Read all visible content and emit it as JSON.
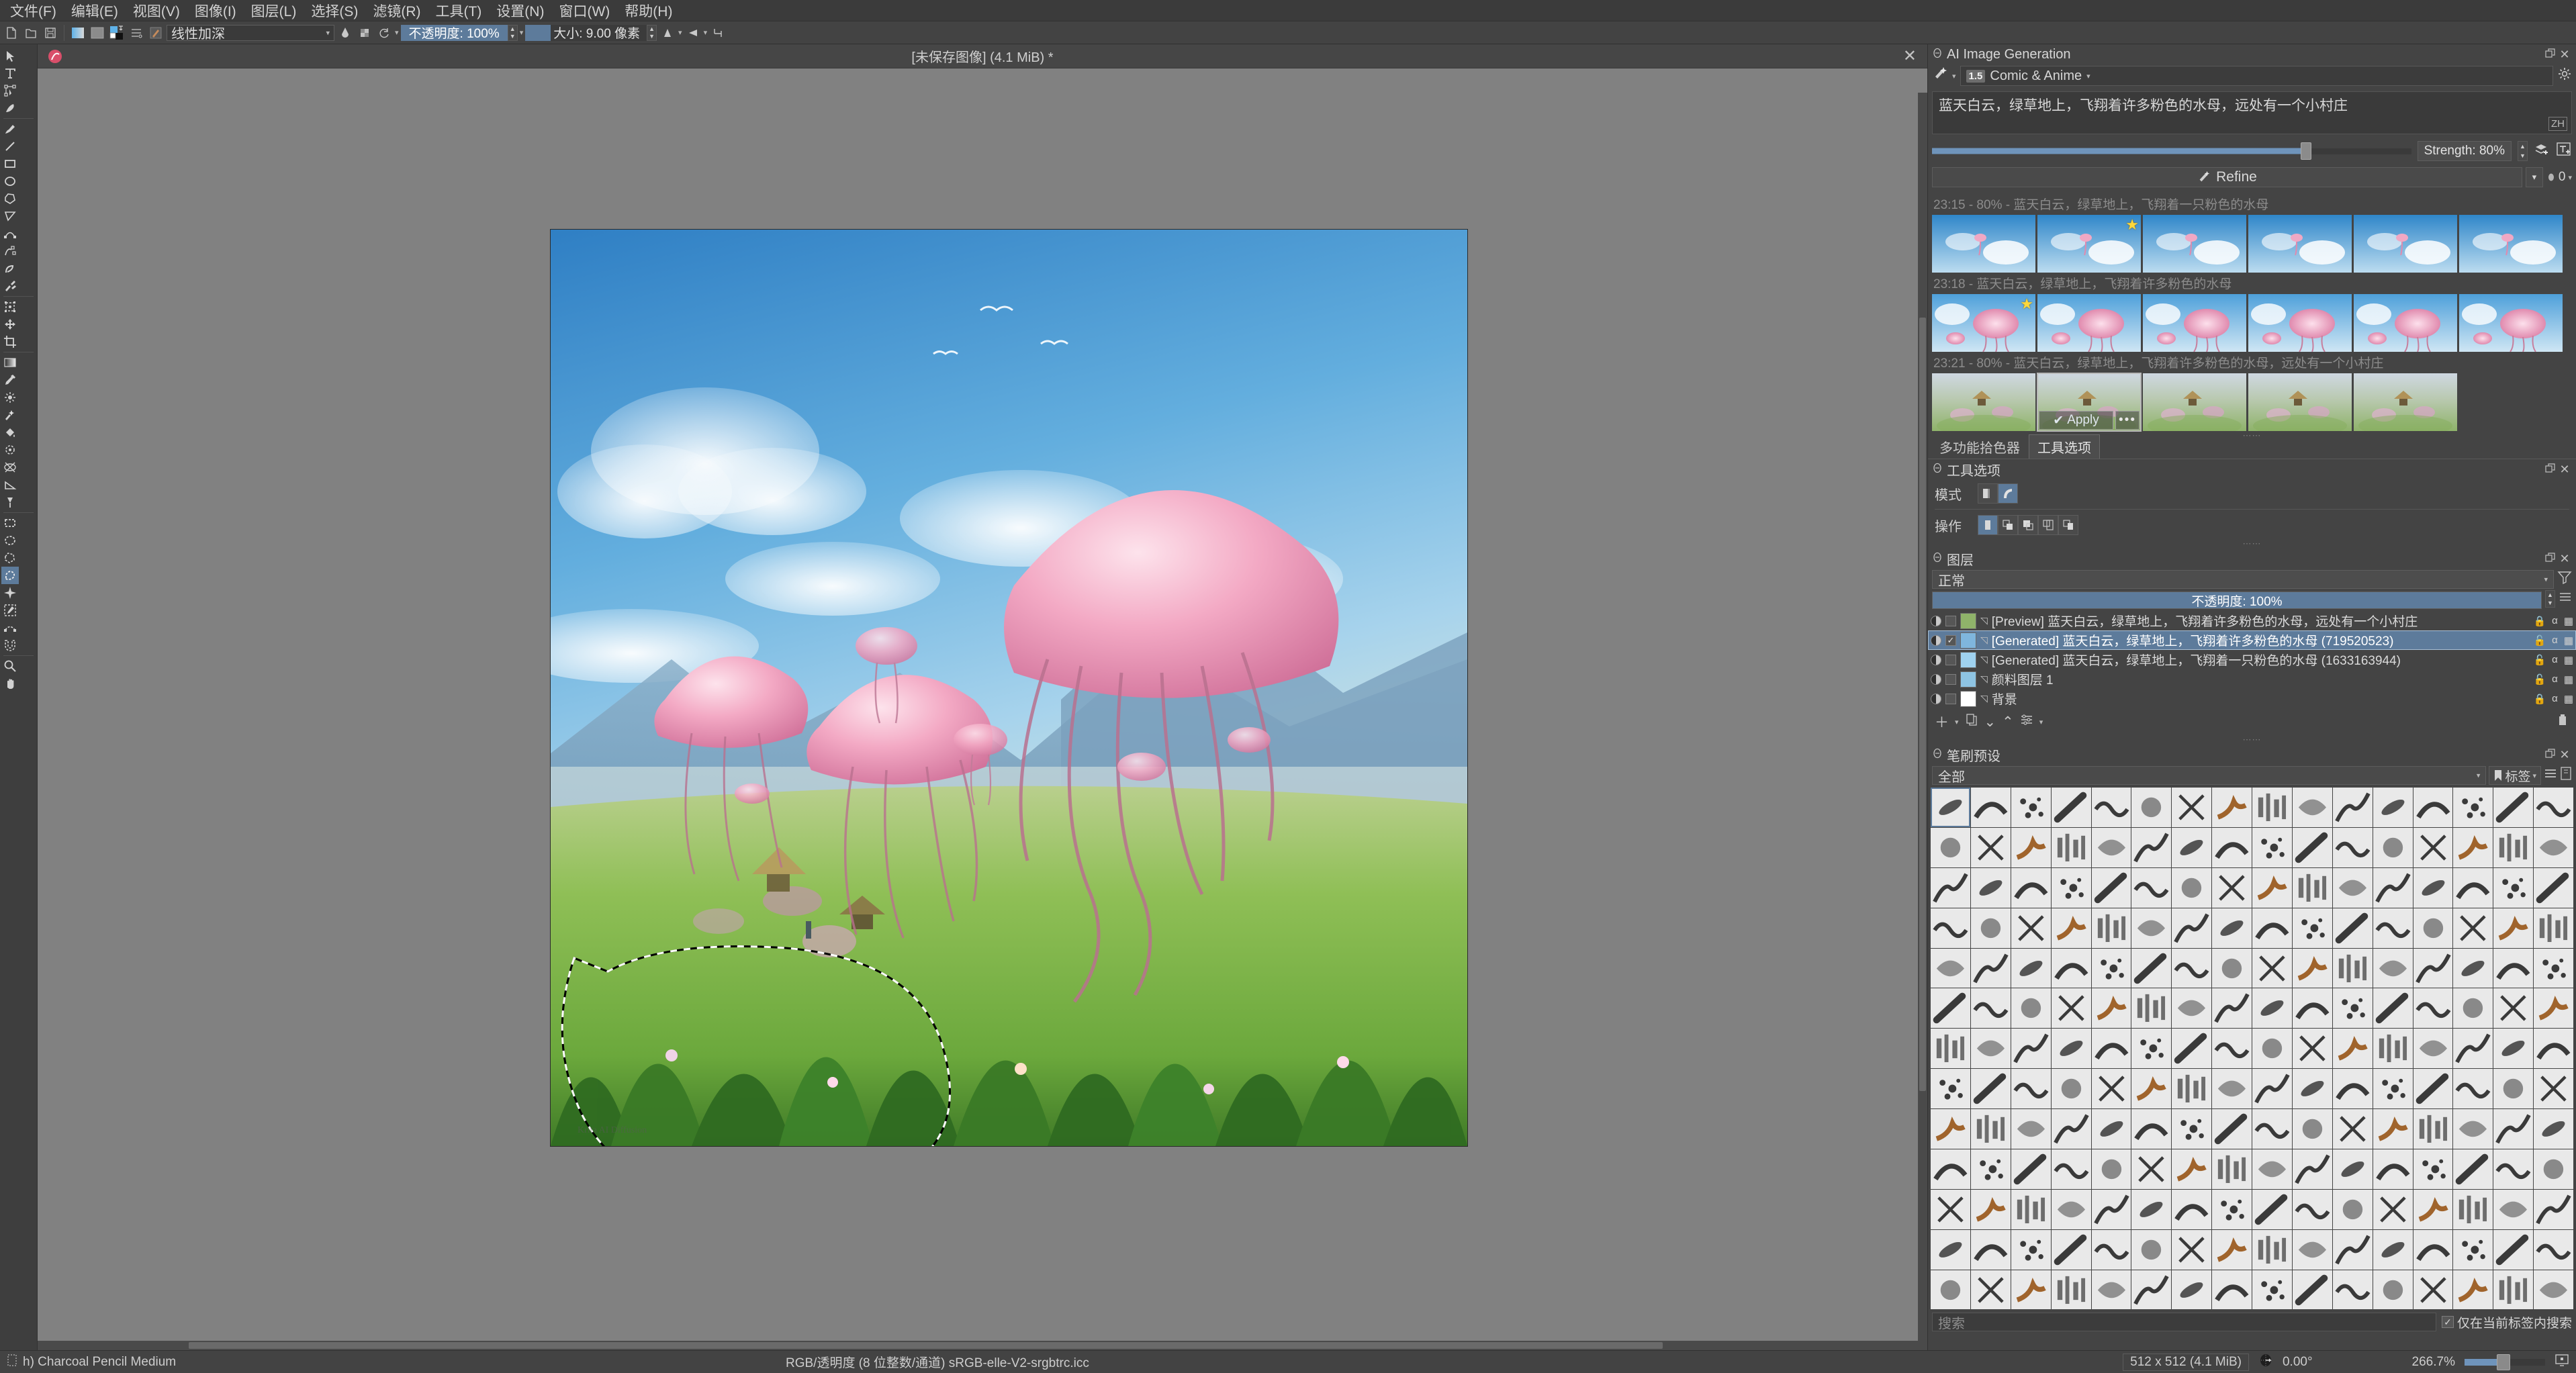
{
  "menu": {
    "items": [
      "文件(F)",
      "编辑(E)",
      "视图(V)",
      "图像(I)",
      "图层(L)",
      "选择(S)",
      "滤镜(R)",
      "工具(T)",
      "设置(N)",
      "窗口(W)",
      "帮助(H)"
    ]
  },
  "toolbar": {
    "icons": [
      "new-document-icon",
      "open-document-icon",
      "save-document-icon",
      "gradient-swatch-icon",
      "pattern-swatch-icon",
      "foreground-background-color-icon",
      "preset-list-icon",
      "brush-preset-icon"
    ],
    "blend_mode": "线性加深",
    "opacity_label": "不透明度: 100%",
    "size_label": "大小: 9.00 像素",
    "eraser_icon": "eraser-icon",
    "alpha_icon": "alpha-lock-icon",
    "reset_icon": "reset-icon",
    "mirror_h_icon": "mirror-horizontal-icon",
    "mirror_v_icon": "mirror-vertical-icon",
    "wrap_icon": "wrap-around-icon"
  },
  "toolbox": {
    "tools": [
      {
        "name": "select-shapes-tool",
        "group": 0
      },
      {
        "name": "text-tool",
        "group": 0
      },
      {
        "name": "edit-shapes-tool",
        "group": 0
      },
      {
        "name": "calligraphy-tool",
        "group": 0
      },
      {
        "name": "freehand-brush-tool",
        "group": 1
      },
      {
        "name": "line-tool",
        "group": 1
      },
      {
        "name": "rectangle-tool",
        "group": 1
      },
      {
        "name": "ellipse-tool",
        "group": 1
      },
      {
        "name": "polygon-tool",
        "group": 1
      },
      {
        "name": "polyline-tool",
        "group": 1
      },
      {
        "name": "bezier-curve-tool",
        "group": 1
      },
      {
        "name": "freehand-path-tool",
        "group": 1
      },
      {
        "name": "dynamic-brush-tool",
        "group": 1
      },
      {
        "name": "multibrush-tool",
        "group": 1
      },
      {
        "name": "transform-tool",
        "group": 2
      },
      {
        "name": "move-tool",
        "group": 2
      },
      {
        "name": "crop-tool",
        "group": 2
      },
      {
        "name": "gradient-tool",
        "group": 3
      },
      {
        "name": "color-picker-tool",
        "group": 3
      },
      {
        "name": "colorize-mask-tool",
        "group": 3
      },
      {
        "name": "smart-patch-tool",
        "group": 3
      },
      {
        "name": "fill-tool",
        "group": 3
      },
      {
        "name": "enclose-and-fill-tool",
        "group": 3
      },
      {
        "name": "assistant-tool",
        "group": 3
      },
      {
        "name": "measure-tool",
        "group": 3
      },
      {
        "name": "reference-images-tool",
        "group": 3
      },
      {
        "name": "rectangular-selection-tool",
        "group": 4
      },
      {
        "name": "elliptical-selection-tool",
        "group": 4
      },
      {
        "name": "polygonal-selection-tool",
        "group": 4
      },
      {
        "name": "freehand-selection-tool",
        "group": 4,
        "active": true
      },
      {
        "name": "contiguous-selection-tool",
        "group": 4
      },
      {
        "name": "similar-color-selection-tool",
        "group": 4
      },
      {
        "name": "bezier-selection-tool",
        "group": 4
      },
      {
        "name": "magnetic-selection-tool",
        "group": 4
      },
      {
        "name": "zoom-tool",
        "group": 5
      },
      {
        "name": "pan-tool",
        "group": 5
      }
    ]
  },
  "document": {
    "title": "[未保存图像]  (4.1 MiB) *",
    "close_icon": "close-icon"
  },
  "ai_panel": {
    "header": "AI Image Generation",
    "lock_icon": "dock-lock-icon",
    "float_icon": "float-dock-icon",
    "close_icon": "close-dock-icon",
    "workspace_icon": "generation-mode-icon",
    "style_badge": "1.5",
    "style": "Comic & Anime",
    "settings_icon": "gear-icon",
    "prompt": "蓝天白云，绿草地上，飞翔着许多粉色的水母，远处有一个小村庄",
    "lang_badge": "ZH",
    "strength": "Strength: 80%",
    "strength_value": 80,
    "add_layer_icon": "add-control-layer-icon",
    "add_text_icon": "add-text-icon",
    "refine_label": "Refine",
    "queue_count": "0",
    "history": [
      {
        "label": "23:15 - 80% - 蓝天白云，绿草地上，飞翔着一只粉色的水母",
        "thumbs": [
          "jellyfish-sky-1",
          "jellyfish-sky-2",
          "jellyfish-sky-3",
          "jellyfish-sky-4",
          "jellyfish-sky-5",
          "jellyfish-sky-6"
        ],
        "starred_index": 1
      },
      {
        "label": "23:18 - 蓝天白云，绿草地上，飞翔着许多粉色的水母",
        "thumbs": [
          "jellyfish-many-1",
          "jellyfish-many-2",
          "jellyfish-many-3",
          "jellyfish-many-4",
          "jellyfish-many-5",
          "jellyfish-many-6"
        ],
        "starred_index": 0
      },
      {
        "label": "23:21 - 80% - 蓝天白云，绿草地上，飞翔着许多粉色的水母，远处有一个小村庄",
        "thumbs": [
          "village-1",
          "village-2",
          "village-3",
          "village-4",
          "village-5"
        ],
        "selected_index": 1,
        "apply_label": "Apply",
        "apply_icon": "check-icon",
        "more_label": "•••"
      }
    ]
  },
  "tool_options": {
    "tabs": [
      {
        "label": "多功能拾色器",
        "active": false
      },
      {
        "label": "工具选项",
        "active": true
      }
    ],
    "header": "工具选项",
    "mode_label": "模式",
    "mode_icons": [
      "pixel-mode-icon",
      "vector-mode-icon"
    ],
    "mode_active": 1,
    "action_label": "操作",
    "action_icons": [
      "replace-selection-icon",
      "add-selection-icon",
      "subtract-selection-icon",
      "intersect-selection-icon",
      "symmetric-difference-icon"
    ],
    "action_active": 0
  },
  "layers": {
    "header": "图层",
    "blend_mode": "正常",
    "filter_icon": "filter-icon",
    "opacity_label": "不透明度: 100%",
    "menu_icon": "layer-menu-icon",
    "rows": [
      {
        "name": "[Preview] 蓝天白云，绿草地上，飞翔着许多粉色的水母，远处有一个小村庄",
        "thumb": "preview-thumb",
        "selected": false,
        "checked": false,
        "locked": true
      },
      {
        "name": "[Generated] 蓝天白云，绿草地上，飞翔着许多粉色的水母 (719520523)",
        "thumb": "generated-thumb-1",
        "selected": true,
        "checked": true,
        "locked": false
      },
      {
        "name": "[Generated] 蓝天白云，绿草地上，飞翔着一只粉色的水母 (1633163944)",
        "thumb": "generated-thumb-2",
        "selected": false,
        "checked": false,
        "locked": false
      },
      {
        "name": "颜料图层 1",
        "thumb": "paint-layer-thumb",
        "selected": false,
        "checked": false,
        "locked": false
      },
      {
        "name": "背景",
        "thumb": "background-thumb",
        "selected": false,
        "checked": false,
        "locked": true
      }
    ],
    "tool_icons": [
      "add-layer-icon",
      "duplicate-layer-icon",
      "move-layer-down-icon",
      "move-layer-up-icon",
      "layer-properties-icon",
      "delete-layer-icon"
    ]
  },
  "brush_presets": {
    "header": "笔刷预设",
    "filter": "全部",
    "tag_label": "标签",
    "tag_icon": "tag-icon",
    "list_icon": "list-view-icon",
    "storage_icon": "resource-storage-icon",
    "search_placeholder": "搜索",
    "search_scope_label": "仅在当前标签内搜索",
    "search_scope_checked": true,
    "rows": 13,
    "cols": 16,
    "selected_cell": 0
  },
  "status": {
    "brush_icon": "brush-preset-icon",
    "brush_name": "h) Charcoal Pencil Medium",
    "color_profile": "RGB/透明度 (8 位整数/通道)  sRGB-elle-V2-srgbtrc.icc",
    "dimensions": "512 x 512 (4.1 MiB)",
    "rotation": "0.00°",
    "zoom": "266.7%",
    "rotation_icon": "canvas-rotation-icon",
    "fit-view-icon": "fit-view-icon"
  },
  "colors": {
    "accent": "#5d7b9b",
    "panel": "#444444",
    "toolbar": "#434343",
    "canvas_bg": "#818181"
  }
}
